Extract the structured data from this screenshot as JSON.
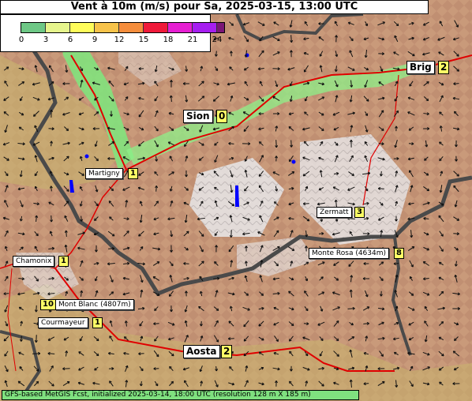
{
  "title": "Vent à 10m (m/s) pour Sa, 2025-03-15, 13:00 UTC",
  "legend": {
    "ticks": [
      "0",
      "3",
      "6",
      "9",
      "12",
      "15",
      "18",
      "21",
      "24"
    ],
    "colors": [
      "#6ec886",
      "#e6f58c",
      "#fffd5a",
      "#f7c34a",
      "#f58d3c",
      "#f01a3a",
      "#e61ed2",
      "#a61ef0",
      "#7a1676"
    ]
  },
  "places": [
    {
      "name": "Brig",
      "value": "2"
    },
    {
      "name": "Sion",
      "value": "0"
    },
    {
      "name": "Martigny",
      "value": "1"
    },
    {
      "name": "Zermatt",
      "value": "3"
    },
    {
      "name": "Monte Rosa (4634m)",
      "value": "8"
    },
    {
      "name": "Chamonix",
      "value": "1"
    },
    {
      "name": "Mont Blanc (4807m)",
      "value": "10"
    },
    {
      "name": "Courmayeur",
      "value": "1"
    },
    {
      "name": "Aosta",
      "value": "2"
    }
  ],
  "footer": "GFS-based MetGIS Fcst, initialized 2025-03-14, 18:00 UTC  (resolution 128 m X 185 m)"
}
